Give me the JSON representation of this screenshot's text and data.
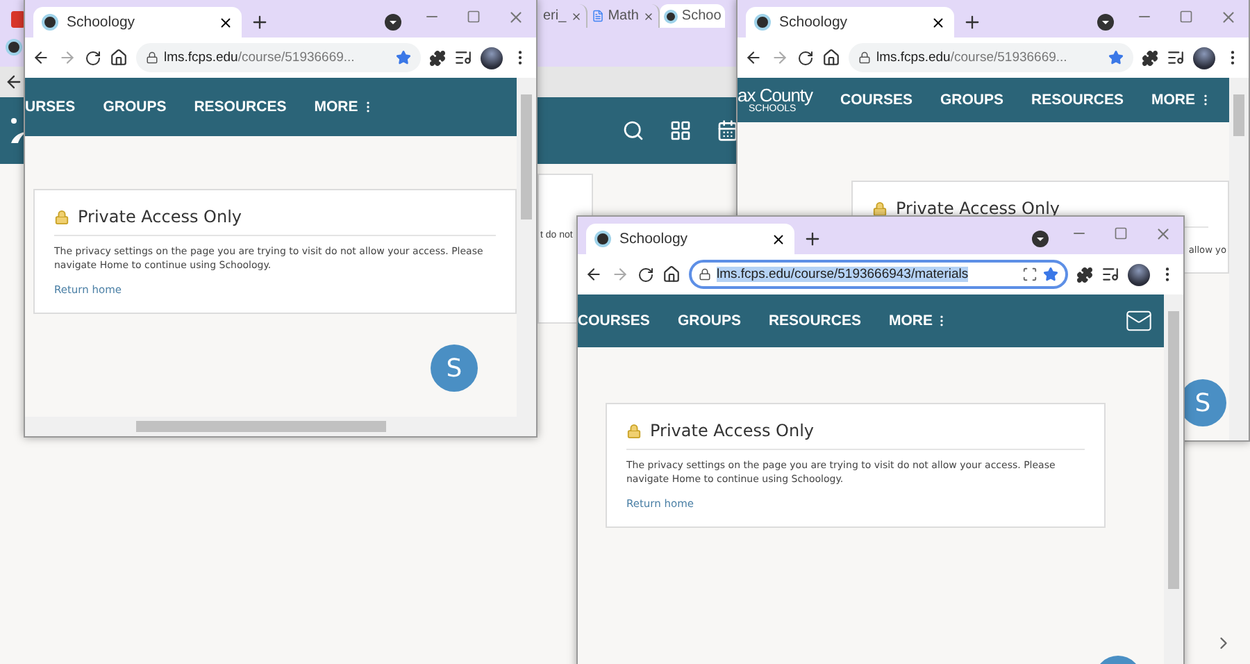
{
  "background_window": {
    "tabs": [
      {
        "title": "eri_",
        "kind": "plain",
        "selected": false
      },
      {
        "title": "Math",
        "kind": "doc",
        "selected": false
      },
      {
        "title": "Schoo",
        "kind": "schoology",
        "selected": true
      }
    ],
    "card_fragment": "t do not"
  },
  "windows": [
    {
      "tab_title": "Schoology",
      "url_host": "lms.fcps.edu",
      "url_path": "/course/51936669...",
      "url_selected": false,
      "nav": [
        "URSES",
        "GROUPS",
        "RESOURCES",
        "MORE"
      ],
      "mail": false,
      "card": {
        "title": "Private Access Only",
        "message_lines": [
          "The privacy settings on the page you are trying to visit do not allow your access. Please",
          "navigate Home to continue using Schoology."
        ],
        "link": "Return home"
      },
      "avatar_letter": "S",
      "hscroll": true
    },
    {
      "tab_title": "Schoology",
      "url_host": "lms.fcps.edu",
      "url_path": "/course/51936669...",
      "url_selected": false,
      "logo_lines": [
        "ax County",
        "SCHOOLS"
      ],
      "nav": [
        "COURSES",
        "GROUPS",
        "RESOURCES",
        "MORE"
      ],
      "mail": false,
      "card": {
        "title": "Private Access Only",
        "fragment": "allow yo"
      },
      "avatar_letter": "S",
      "hscroll": false
    },
    {
      "tab_title": "Schoology",
      "url_host": "lms.fcps.edu",
      "url_path": "/course/5193666943/materials",
      "url_selected": true,
      "nav": [
        "COURSES",
        "GROUPS",
        "RESOURCES",
        "MORE"
      ],
      "mail": true,
      "card": {
        "title": "Private Access Only",
        "message_lines": [
          "The privacy settings on the page you are trying to visit do not allow your access. Please",
          "navigate Home to continue using Schoology."
        ],
        "link": "Return home"
      },
      "hscroll": false
    }
  ]
}
